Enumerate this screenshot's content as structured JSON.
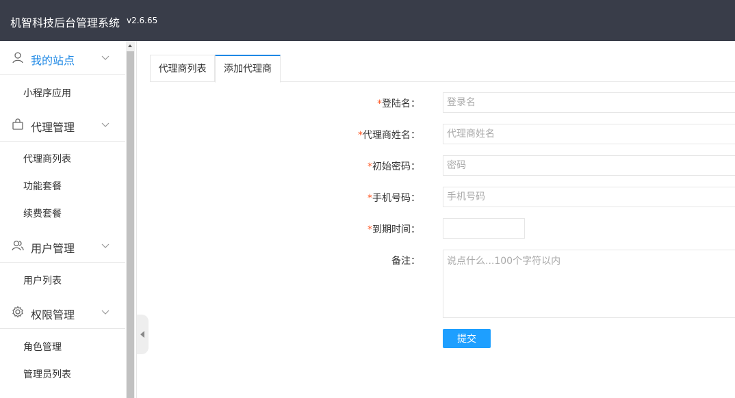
{
  "header": {
    "title": "机智科技后台管理系统",
    "version": "v2.6.65"
  },
  "sidebar": {
    "groups": [
      {
        "label": "我的站点",
        "icon": "user-icon",
        "items": [
          "小程序应用"
        ]
      },
      {
        "label": "代理管理",
        "icon": "shopping-bag-icon",
        "items": [
          "代理商列表",
          "功能套餐",
          "续费套餐"
        ]
      },
      {
        "label": "用户管理",
        "icon": "users-icon",
        "items": [
          "用户列表"
        ]
      },
      {
        "label": "权限管理",
        "icon": "gear-icon",
        "items": [
          "角色管理",
          "管理员列表"
        ]
      }
    ]
  },
  "tabs": [
    {
      "label": "代理商列表"
    },
    {
      "label": "添加代理商"
    }
  ],
  "form": {
    "login_name": {
      "label": "登陆名：",
      "placeholder": "登录名"
    },
    "agent_name": {
      "label": "代理商姓名：",
      "placeholder": "代理商姓名"
    },
    "password": {
      "label": "初始密码：",
      "placeholder": "密码"
    },
    "phone": {
      "label": "手机号码：",
      "placeholder": "手机号码"
    },
    "expire": {
      "label": "到期时间：",
      "placeholder": ""
    },
    "remark": {
      "label": "备注：",
      "placeholder": "说点什么...100个字符以内"
    },
    "required_mark": "*",
    "submit_label": "提交"
  },
  "colors": {
    "header_bg": "#393d49",
    "accent": "#1e88e5",
    "button": "#1e9fff",
    "required": "#ff5722"
  }
}
